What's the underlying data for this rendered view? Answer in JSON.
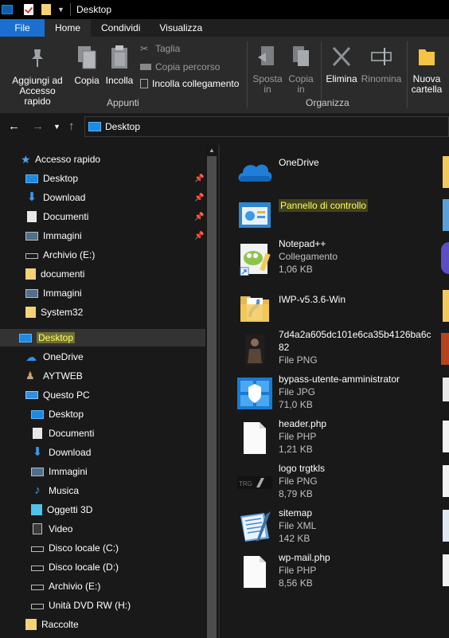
{
  "window": {
    "title": "Desktop"
  },
  "tabs": [
    "File",
    "Home",
    "Condividi",
    "Visualizza"
  ],
  "ribbon": {
    "pin_label": "Aggiungi ad\nAccesso rapido",
    "pin_line1": "Aggiungi ad",
    "pin_line2": "Accesso rapido",
    "copy": "Copia",
    "paste": "Incolla",
    "cut": "Taglia",
    "copy_path": "Copia percorso",
    "paste_shortcut": "Incolla collegamento",
    "group_clipboard": "Appunti",
    "move_to_1": "Sposta",
    "move_to_2": "in",
    "copy_to_1": "Copia",
    "copy_to_2": "in",
    "delete": "Elimina",
    "rename": "Rinomina",
    "group_organize": "Organizza",
    "new_folder_1": "Nuova",
    "new_folder_2": "cartella"
  },
  "address": {
    "path": "Desktop"
  },
  "nav": {
    "quick_access": "Accesso rapido",
    "quick": [
      {
        "label": "Desktop",
        "pinned": true
      },
      {
        "label": "Download",
        "pinned": true
      },
      {
        "label": "Documenti",
        "pinned": true
      },
      {
        "label": "Immagini",
        "pinned": true
      },
      {
        "label": "Archivio (E:)"
      },
      {
        "label": "documenti"
      },
      {
        "label": "Immagini"
      },
      {
        "label": "System32"
      }
    ],
    "desktop": "Desktop",
    "onedrive": "OneDrive",
    "user": "AYTWEB",
    "this_pc": "Questo PC",
    "pc_items": [
      "Desktop",
      "Documenti",
      "Download",
      "Immagini",
      "Musica",
      "Oggetti 3D",
      "Video",
      "Disco locale (C:)",
      "Disco locale (D:)",
      "Archivio (E:)",
      "Unità DVD RW (H:)"
    ],
    "raccolte": "Raccolte"
  },
  "files": [
    {
      "name": "OneDrive",
      "type": "",
      "size": "",
      "icon": "cloud-icon"
    },
    {
      "name": "Pannello di controllo",
      "type": "",
      "size": "",
      "icon": "control-panel-icon"
    },
    {
      "name": "Notepad++",
      "type": "Collegamento",
      "size": "1,06 KB",
      "icon": "notepadpp-icon"
    },
    {
      "name": "IWP-v5.3.6-Win",
      "type": "",
      "size": "",
      "icon": "folder-icon"
    },
    {
      "name": "7d4a2a605dc101e6ca35b4126ba6c",
      "name2": "82",
      "type": "File PNG",
      "size": "",
      "icon": "image-icon"
    },
    {
      "name": "bypass-utente-amministrator",
      "type": "File JPG",
      "size": "71,0 KB",
      "icon": "image-icon"
    },
    {
      "name": "header.php",
      "type": "File PHP",
      "size": "1,21 KB",
      "icon": "file-icon"
    },
    {
      "name": "logo trgtkls",
      "type": "File PNG",
      "size": "8,79 KB",
      "icon": "image-icon"
    },
    {
      "name": "sitemap",
      "type": "File XML",
      "size": "142 KB",
      "icon": "xml-icon"
    },
    {
      "name": "wp-mail.php",
      "type": "File PHP",
      "size": "8,56 KB",
      "icon": "file-icon"
    }
  ]
}
